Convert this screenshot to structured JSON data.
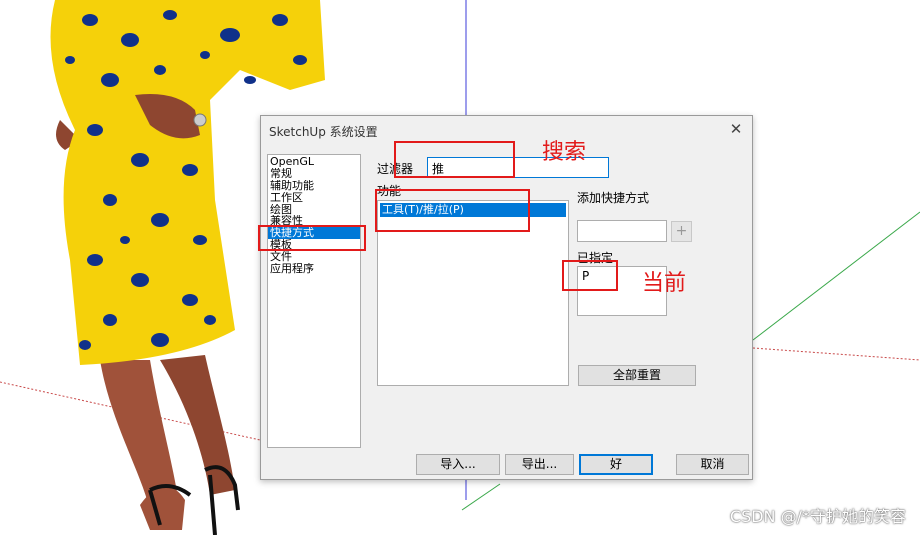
{
  "dialog": {
    "title": "SketchUp 系统设置",
    "close_icon": "close-icon",
    "categories": [
      {
        "label": "OpenGL",
        "selected": false
      },
      {
        "label": "常规",
        "selected": false
      },
      {
        "label": "辅助功能",
        "selected": false
      },
      {
        "label": "工作区",
        "selected": false
      },
      {
        "label": "绘图",
        "selected": false
      },
      {
        "label": "兼容性",
        "selected": false
      },
      {
        "label": "快捷方式",
        "selected": true
      },
      {
        "label": "模板",
        "selected": false
      },
      {
        "label": "文件",
        "selected": false
      },
      {
        "label": "应用程序",
        "selected": false
      }
    ],
    "filter_label": "过滤器",
    "filter_value": "推",
    "function_label": "功能",
    "function_items": [
      "工具(T)/推/拉(P)"
    ],
    "add_shortcut_label": "添加快捷方式",
    "add_shortcut_value": "",
    "add_button_label": "+",
    "assigned_label": "已指定",
    "assigned_value": "P",
    "reset_all_label": "全部重置",
    "import_label": "导入...",
    "export_label": "导出...",
    "ok_label": "好",
    "cancel_label": "取消",
    "selection_color": "#0078d7"
  },
  "annotations": {
    "search_label": "搜索",
    "current_label": "当前",
    "color": "#e21a1a"
  },
  "watermark": "CSDN @/*守护她的笑容"
}
